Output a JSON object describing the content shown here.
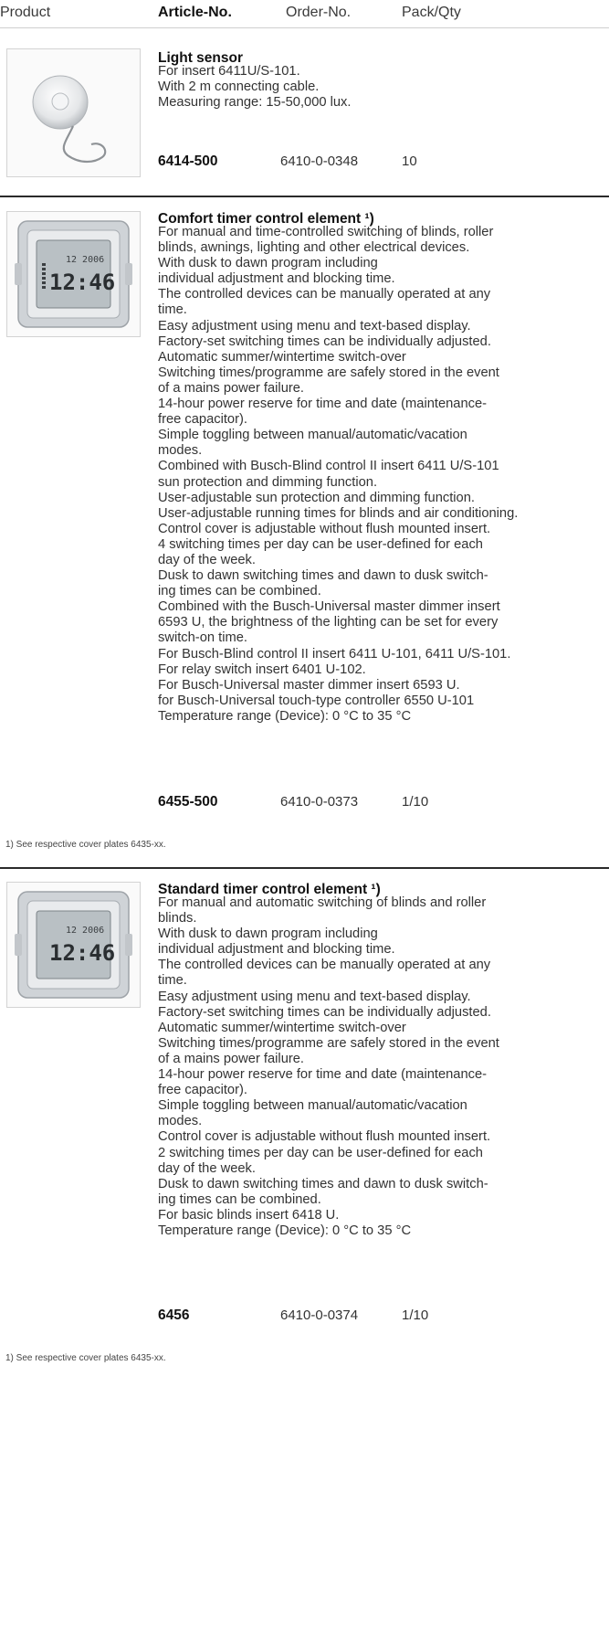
{
  "header": {
    "product": "Product",
    "article_no": "Article-No.",
    "order_no": "Order-No.",
    "pack_qty": "Pack/Qty"
  },
  "products": [
    {
      "title": "Light sensor",
      "image_icon": "light-sensor-icon",
      "description": [
        "For insert 6411U/S-101.",
        "With 2 m connecting cable.",
        "Measuring range: 15-50,000 lux."
      ],
      "article_no": "6414-500",
      "order_no": "6410-0-0348",
      "pack_qty": "10",
      "footnote": ""
    },
    {
      "title": "Comfort timer control element ¹)",
      "image_icon": "timer-display-icon",
      "display_time": "12:46",
      "display_date": "12 2006",
      "description": [
        "For manual and time-controlled switching of blinds, roller",
        "blinds, awnings, lighting and other electrical devices.",
        "With dusk to dawn program including",
        "individual adjustment and blocking time.",
        "The controlled devices can be manually operated at any",
        "time.",
        "Easy adjustment using menu and text-based display.",
        "Factory-set switching times can be individually adjusted.",
        "Automatic summer/wintertime switch-over",
        "Switching times/programme are safely stored in the event",
        "of a mains power failure.",
        "14-hour power reserve for time and date (maintenance-",
        "free capacitor).",
        "Simple toggling between manual/automatic/vacation",
        "modes.",
        "Combined with Busch-Blind control II insert 6411 U/S-101",
        "sun protection and dimming function.",
        "User-adjustable sun protection and dimming function.",
        "User-adjustable running times for blinds and air conditioning.",
        "Control cover is adjustable without flush mounted insert.",
        "4 switching times per day can be user-defined for each",
        "day of the week.",
        "Dusk to dawn switching times and dawn to dusk switch-",
        "ing times can be combined.",
        "Combined with the Busch-Universal master dimmer insert",
        "6593 U, the brightness of the lighting can be set for every",
        "switch-on time.",
        "For Busch-Blind control II insert 6411 U-101, 6411 U/S-101.",
        "For relay switch insert 6401 U-102.",
        "For Busch-Universal master dimmer insert 6593 U.",
        "for Busch-Universal touch-type controller 6550 U-101",
        "Temperature range (Device): 0 °C to 35 °C"
      ],
      "article_no": "6455-500",
      "order_no": "6410-0-0373",
      "pack_qty": "1/10",
      "footnote": "1)  See respective cover plates 6435-xx."
    },
    {
      "title": "Standard timer control element ¹)",
      "image_icon": "timer-display-icon",
      "display_time": "12:46",
      "display_date": "12 2006",
      "description": [
        "For manual and automatic switching of blinds and roller",
        "blinds.",
        "With dusk to dawn program including",
        "individual adjustment and blocking time.",
        "The controlled devices can be manually operated at any",
        "time.",
        "Easy adjustment using menu and text-based display.",
        "Factory-set switching times can be individually adjusted.",
        "Automatic summer/wintertime switch-over",
        "Switching times/programme are safely stored in the event",
        "of a mains power failure.",
        "14-hour power reserve for time and date (maintenance-",
        "free capacitor).",
        "Simple toggling between manual/automatic/vacation",
        "modes.",
        "Control cover is adjustable without flush mounted insert.",
        "2 switching times per day can be user-defined for each",
        "day of the week.",
        "Dusk to dawn switching times and dawn to dusk switch-",
        "ing times can be combined.",
        "For basic blinds insert 6418 U.",
        "Temperature range (Device): 0 °C to 35 °C"
      ],
      "article_no": "6456",
      "order_no": "6410-0-0374",
      "pack_qty": "1/10",
      "footnote": "1)  See respective cover plates 6435-xx."
    }
  ]
}
